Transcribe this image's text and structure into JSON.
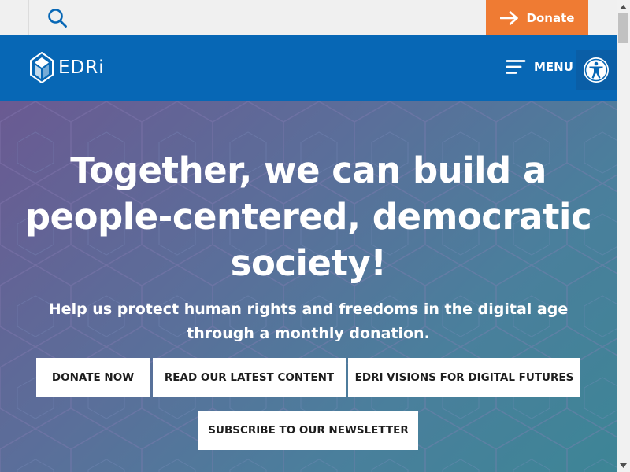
{
  "topbar": {
    "search_icon": "search-icon",
    "donate_label": "Donate",
    "donate_icon": "arrow-right-icon"
  },
  "header": {
    "logo_text": "EDRi",
    "menu_label": "MENU",
    "menu_icon": "hamburger-icon",
    "accessibility_icon": "accessibility-icon"
  },
  "hero": {
    "title_lines": [
      "Together, we can build a",
      "people-centered, democratic",
      "society!"
    ],
    "subtitle": "Help us protect human rights and freedoms in the digital age through a monthly donation.",
    "buttons": {
      "donate_now": "DONATE NOW",
      "read_latest": "READ OUR LATEST CONTENT",
      "visions": "EDRI VISIONS FOR DIGITAL FUTURES",
      "subscribe": "SUBSCRIBE TO OUR NEWSLETTER"
    }
  },
  "colors": {
    "header_blue": "#0767b5",
    "donate_orange": "#ef7b33",
    "hero_gradient_start": "#6a5a92",
    "hero_gradient_end": "#3d8596"
  }
}
